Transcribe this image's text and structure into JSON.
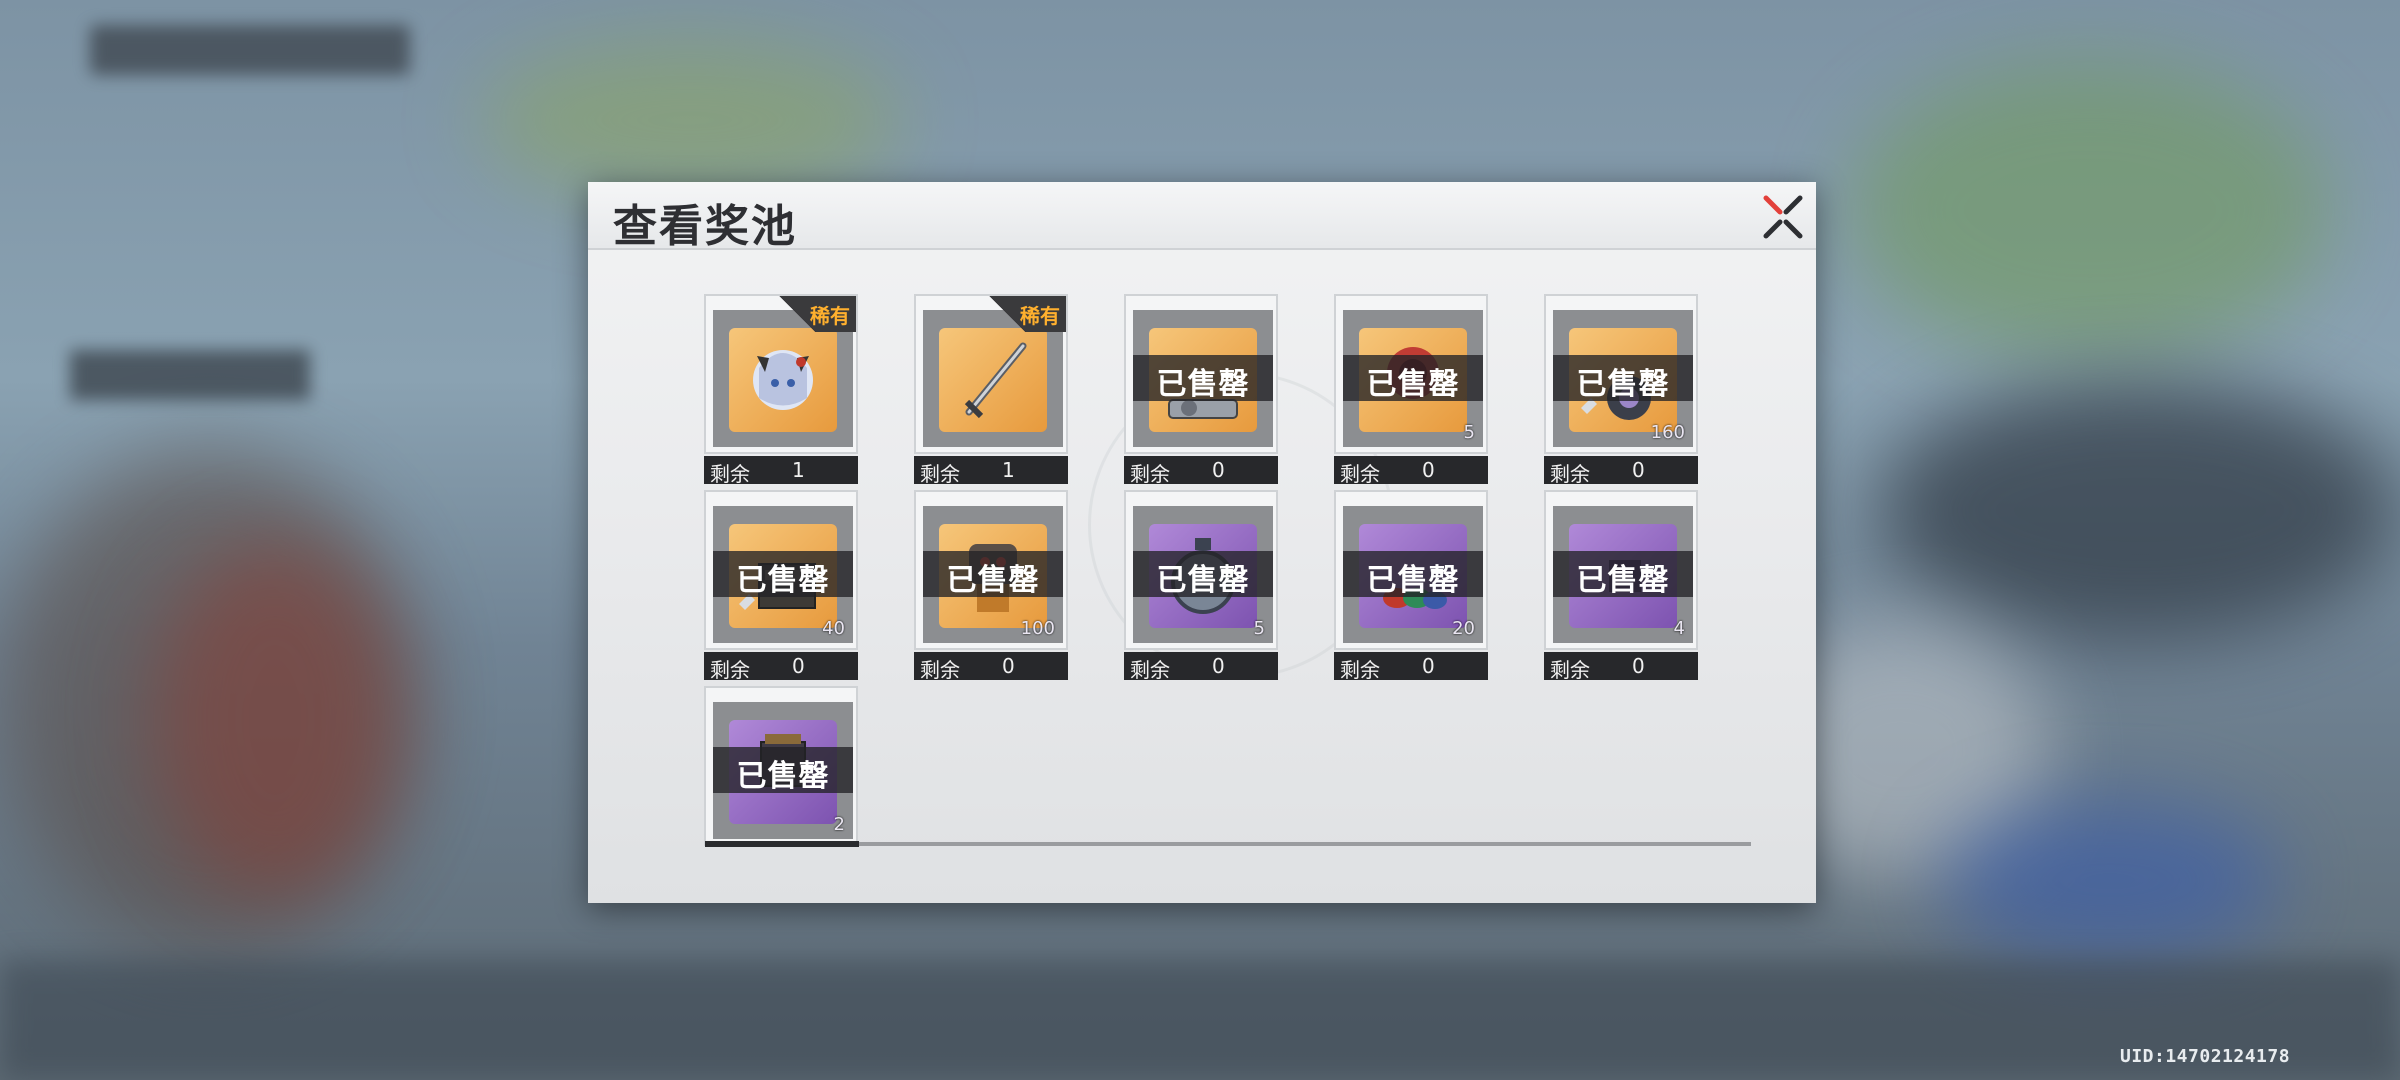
{
  "dialog": {
    "title": "查看奖池"
  },
  "footer": {
    "uid": "UID:14702124178"
  },
  "labels": {
    "remain": "剩余",
    "sold_out": "已售罄",
    "rare": "稀有"
  },
  "items": [
    {
      "name": "character-fragment",
      "icon": "character-portrait-icon",
      "bg": "gold",
      "rare": true,
      "sold_out": false,
      "count": "",
      "remain": "1"
    },
    {
      "name": "weapon-sword",
      "icon": "sword-icon",
      "bg": "gold",
      "rare": true,
      "sold_out": false,
      "count": "",
      "remain": "1"
    },
    {
      "name": "gold-material-1",
      "icon": "medal-icon",
      "bg": "gold",
      "rare": false,
      "sold_out": true,
      "count": "",
      "remain": "0"
    },
    {
      "name": "gold-material-2",
      "icon": "red-gem-icon",
      "bg": "gold",
      "rare": false,
      "sold_out": true,
      "count": "5",
      "remain": "0"
    },
    {
      "name": "gold-material-3",
      "icon": "gear-part-icon",
      "bg": "gold",
      "rare": false,
      "sold_out": true,
      "count": "160",
      "remain": "0"
    },
    {
      "name": "gold-material-4",
      "icon": "crate-icon",
      "bg": "gold",
      "rare": false,
      "sold_out": true,
      "count": "40",
      "remain": "0"
    },
    {
      "name": "gold-material-5",
      "icon": "robot-icon",
      "bg": "gold",
      "rare": false,
      "sold_out": true,
      "count": "100",
      "remain": "0"
    },
    {
      "name": "purple-material-1",
      "icon": "clock-icon",
      "bg": "purple",
      "rare": false,
      "sold_out": true,
      "count": "5",
      "remain": "0"
    },
    {
      "name": "purple-material-2",
      "icon": "capsule-icon",
      "bg": "purple",
      "rare": false,
      "sold_out": true,
      "count": "20",
      "remain": "0"
    },
    {
      "name": "purple-material-3",
      "icon": "chip-icon",
      "bg": "purple",
      "rare": false,
      "sold_out": true,
      "count": "4",
      "remain": "0"
    },
    {
      "name": "purple-material-4",
      "icon": "box-icon",
      "bg": "purple",
      "rare": false,
      "sold_out": true,
      "count": "2",
      "remain": "",
      "partial": true
    }
  ],
  "colors": {
    "rare_text": "#ffb02e",
    "close_x_red": "#e2403a",
    "close_x_dark": "#2d2f33"
  }
}
